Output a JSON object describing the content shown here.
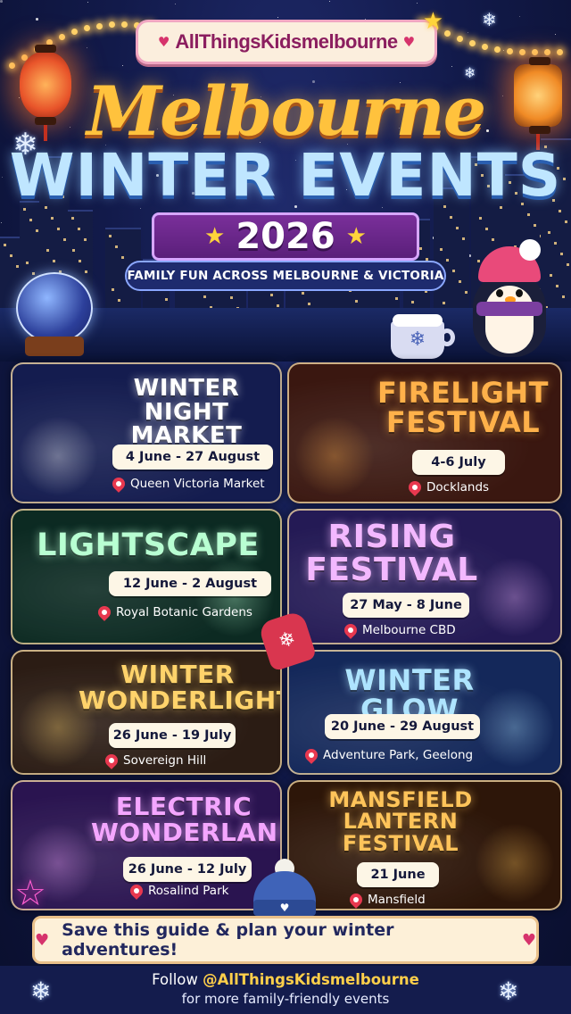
{
  "brand": {
    "name": "AllThingsKidsmelbourne"
  },
  "header": {
    "title_line1": "Melbourne",
    "title_line2": "WINTER EVENTS",
    "year": "2026",
    "tagline": "FAMILY FUN ACROSS MELBOURNE & VICTORIA"
  },
  "events": [
    {
      "title_lines": [
        "WINTER",
        "NIGHT MARKET"
      ],
      "dates": "4 June - 27 August",
      "location": "Queen Victoria Market",
      "accent": "#ffffff",
      "background": "#141c4f"
    },
    {
      "title_lines": [
        "FIRELIGHT",
        "FESTIVAL"
      ],
      "dates": "4-6 July",
      "location": "Docklands",
      "accent": "#ffb14a",
      "background": "#3a1710"
    },
    {
      "title_lines": [
        "LIGHTSCAPE"
      ],
      "dates": "12 June - 2 August",
      "location": "Royal Botanic Gardens",
      "accent": "#b8ffd2",
      "background": "#0c2a22"
    },
    {
      "title_lines": [
        "RISING",
        "FESTIVAL"
      ],
      "dates": "27 May - 8 June",
      "location": "Melbourne CBD",
      "accent": "#f3b8ff",
      "background": "#241a55"
    },
    {
      "title_lines": [
        "WINTER",
        "WONDERLIGHTS"
      ],
      "dates": "26 June - 19 July",
      "location": "Sovereign Hill",
      "accent": "#ffd36b",
      "background": "#2b1c14"
    },
    {
      "title_lines": [
        "WINTER GLOW"
      ],
      "dates": "20 June - 29 August",
      "location": "Adventure Park, Geelong",
      "accent": "#aee4ff",
      "background": "#14285a"
    },
    {
      "title_lines": [
        "ELECTRIC",
        "WONDERLAND"
      ],
      "dates": "26 June - 12 July",
      "location": "Rosalind Park",
      "accent": "#f4a6ff",
      "background": "#2a1450"
    },
    {
      "title_lines": [
        "MANSFIELD",
        "LANTERN",
        "FESTIVAL"
      ],
      "dates": "21 June",
      "location": "Mansfield",
      "accent": "#ffc45a",
      "background": "#2d1609"
    }
  ],
  "footer": {
    "save_text": "Save this guide & plan your winter adventures!",
    "follow_prefix": "Follow",
    "handle": "@AllThingsKidsmelbourne",
    "follow_suffix": "for more family-friendly events"
  },
  "icons": {
    "pin": "location-pin-icon",
    "snowflake": "snowflake-icon",
    "heart": "heart-icon",
    "star": "star-icon"
  },
  "colors": {
    "page_background": "#0b1030",
    "title_gold": "#ffc23d",
    "title_ice": "#bfe6ff",
    "banner_purple": "#7a2f9a",
    "pill_cream": "#fdf6e6",
    "pin_red": "#e8384f",
    "handle_yellow": "#ffcf4a"
  }
}
